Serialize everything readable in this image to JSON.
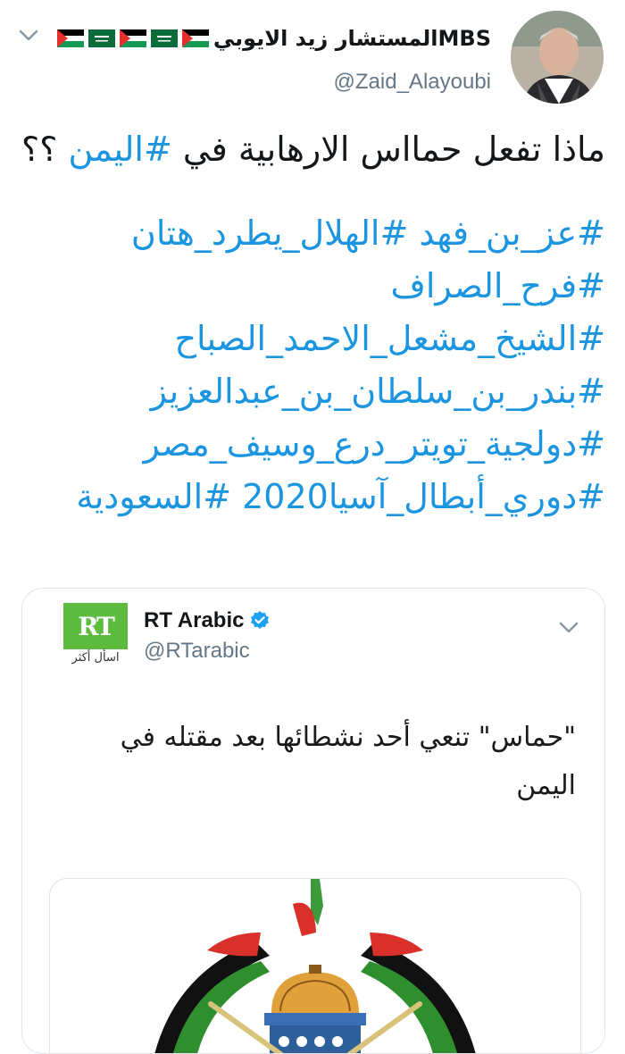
{
  "tweet": {
    "display_name": "المستشار زيد الايوبيMBS",
    "handle": "@Zaid_Alayoubi",
    "text_plain": "ماذا تفعل حمااس الارهابية في",
    "text_hashtag": "#اليمن",
    "text_suffix": "؟؟",
    "hashtags": [
      "#عز_بن_فهد #الهلال_يطرد_هتان",
      "#فرح_الصراف",
      "#الشيخ_مشعل_الاحمد_الصباح",
      "#بندر_بن_سلطان_بن_عبدالعزيز",
      "#دولجية_تويتر_درع_وسيف_مصر",
      "#دوري_أبطال_آسيا2020 #السعودية"
    ]
  },
  "quoted_tweet": {
    "display_name": "RT Arabic",
    "handle": "@RTarabic",
    "logo_text": "RT",
    "logo_tagline": "اسأل أكثر",
    "text": "\"حماس\" تنعي أحد نشطائها بعد مقتله في اليمن"
  },
  "colors": {
    "link": "#1b95e0",
    "secondary_text": "#657786",
    "verified": "#1da1f2",
    "rt_green": "#5dbb3f"
  },
  "icons": [
    "chevron-down-icon",
    "verified-badge-icon",
    "flag-icon"
  ]
}
